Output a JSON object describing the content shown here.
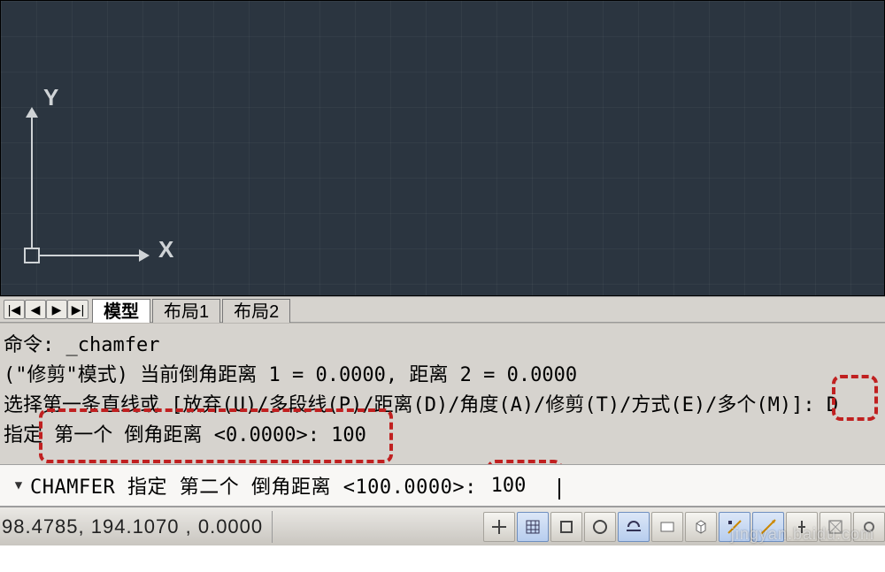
{
  "axes": {
    "x_label": "X",
    "y_label": "Y"
  },
  "tabs": {
    "nav": {
      "first": "|◀",
      "prev": "◀",
      "next": "▶",
      "last": "▶|"
    },
    "items": [
      {
        "label": "模型",
        "active": true
      },
      {
        "label": "布局1",
        "active": false
      },
      {
        "label": "布局2",
        "active": false
      }
    ]
  },
  "history": {
    "line1": "命令: _chamfer",
    "line2": "(\"修剪\"模式) 当前倒角距离 1 = 0.0000, 距离 2 = 0.0000",
    "line3": "选择第一条直线或 [放弃(U)/多段线(P)/距离(D)/角度(A)/修剪(T)/方式(E)/多个(M)]: D",
    "line4": "指定 第一个 倒角距离 <0.0000>: 100"
  },
  "cmd_input": {
    "prompt": "CHAMFER 指定 第二个 倒角距离 <100.0000>: ",
    "value": "100"
  },
  "status": {
    "coords": "98.4785, 194.1070 , 0.0000",
    "watermark": "jingyan.baidu.com"
  },
  "icons": {
    "snap": "snap-icon",
    "grid": "grid-icon",
    "ortho": "ortho-icon",
    "polar": "polar-icon",
    "osnap": "osnap-icon",
    "otrack": "otrack-icon",
    "dyn": "dyn-icon",
    "lwt": "lwt-icon",
    "model": "model-icon",
    "qprops": "qprops-icon",
    "selcyc": "selcyc-icon",
    "plus": "plus-icon"
  }
}
